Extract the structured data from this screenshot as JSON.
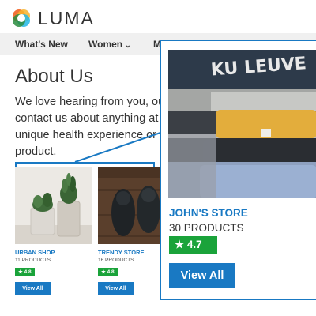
{
  "header": {
    "logo_text": "LUMA",
    "logo_colors": [
      "#f26322",
      "#f7b32b",
      "#22b8e8",
      "#2a8c3e"
    ]
  },
  "nav": {
    "items": [
      {
        "label": "What's New"
      },
      {
        "label": "Women"
      },
      {
        "label": "M"
      }
    ]
  },
  "main": {
    "title": "About Us",
    "intro_lines": [
      "We love hearing from you, ou",
      "contact us about anything at",
      "unique health experience or",
      "product."
    ]
  },
  "stores": [
    {
      "name": "URBAN SHOP",
      "count": "11 PRODUCTS",
      "rating": "4.8",
      "button": "View All",
      "image": "potted-succulents"
    },
    {
      "name": "TRENDY STORE",
      "count": "16 PRODUCTS",
      "rating": "4.8",
      "button": "View All",
      "image": "dark-boots-on-wood"
    }
  ],
  "zoom": {
    "name": "JOHN'S STORE",
    "count": "30 PRODUCTS",
    "rating": "4.7",
    "button": "View All",
    "image": "folded-t-shirts",
    "shirt_print": "KU LEUVE"
  },
  "colors": {
    "accent": "#1979c3",
    "rating_green": "#1aa33a",
    "nav_bg": "#f0f0f0"
  }
}
